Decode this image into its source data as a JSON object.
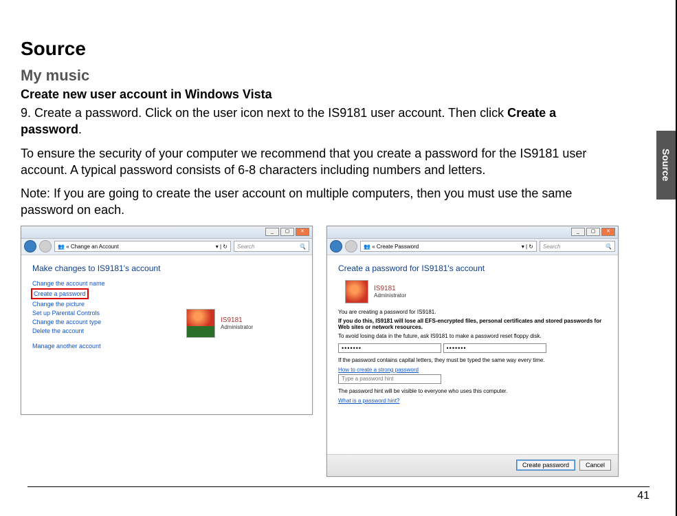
{
  "sideTab": "Source",
  "h1": "Source",
  "h2": "My music",
  "h3": "Create new user account in Windows Vista",
  "stepNumber": "9.",
  "stepTextA": "Create a password. Click on the user icon next to the IS9181 user account. Then click ",
  "stepBold": "Create a password",
  "stepTextB": ".",
  "para1": "To ensure the security of your computer we recommend that you create a password for the IS9181 user account. A typical password consists of 6-8 characters including numbers and letters.",
  "para2": "Note: If you are going to create the user account on multiple computers, then you must use the same password on each.",
  "pageNumber": "41",
  "left": {
    "breadcrumb": "«  Change an Account",
    "searchPlaceholder": "Search",
    "heading": "Make changes to IS9181's account",
    "links": {
      "name": "Change the account name",
      "password": "Create a password",
      "picture": "Change the picture",
      "parental": "Set up Parental Controls",
      "type": "Change the account type",
      "delete": "Delete the account",
      "manage": "Manage another account"
    },
    "userName": "IS9181",
    "userRole": "Administrator"
  },
  "right": {
    "breadcrumb": "«  Create Password",
    "searchPlaceholder": "Search",
    "heading": "Create a password for IS9181's account",
    "userName": "IS9181",
    "userRole": "Administrator",
    "note1": "You are creating a password for IS9181.",
    "note2": "If you do this, IS9181 will lose all EFS-encrypted files, personal certificates and stored passwords for Web sites or network resources.",
    "note3": "To avoid losing data in the future, ask IS9181 to make a password reset floppy disk.",
    "pwdValue": "•••••••",
    "note4": "If the password contains capital letters, they must be typed the same way every time.",
    "link1": "How to create a strong password",
    "hintPlaceholder": "Type a password hint",
    "note5": "The password hint will be visible to everyone who uses this computer.",
    "link2": "What is a password hint?",
    "btnCreate": "Create password",
    "btnCancel": "Cancel"
  }
}
